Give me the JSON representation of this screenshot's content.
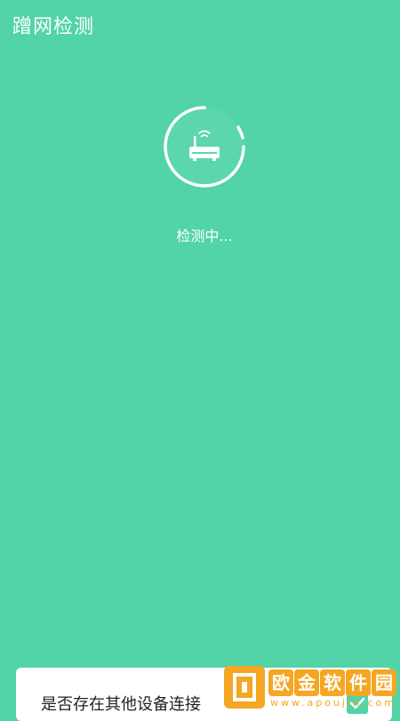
{
  "header": {
    "title": "蹭网检测"
  },
  "scan": {
    "icon": "router-icon",
    "status": "检测中..."
  },
  "bottom_card": {
    "question": "是否存在其他设备连接",
    "checkbox_checked": true
  },
  "watermark": {
    "chars": [
      "欧",
      "金",
      "软",
      "件",
      "园"
    ],
    "url": "www.apoujin.com"
  },
  "colors": {
    "background": "#52D3A8",
    "card": "#ffffff",
    "accent": "#52D3A8",
    "watermark": "#F5A623"
  }
}
